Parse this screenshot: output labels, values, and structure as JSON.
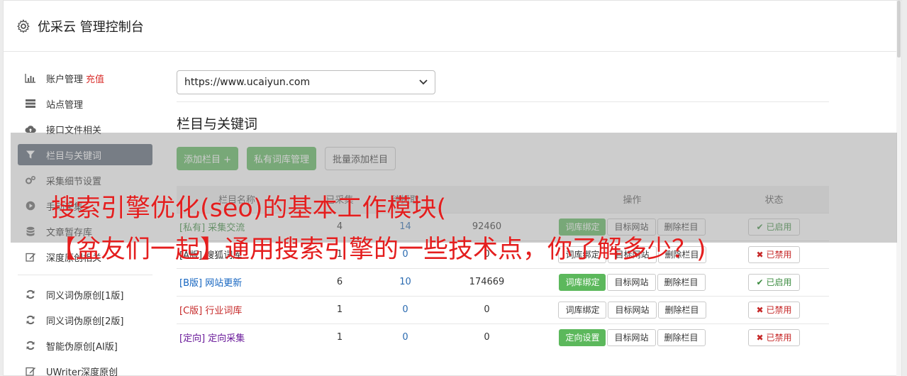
{
  "header": {
    "title": "优采云 管理控制台"
  },
  "sidebar": {
    "items": [
      {
        "label": "账户管理",
        "badge": "充值",
        "icon": "bar-chart-icon"
      },
      {
        "label": "站点管理",
        "icon": "server-icon"
      },
      {
        "label": "接口文件相关",
        "icon": "cloud-upload-icon"
      },
      {
        "label": "栏目与关键词",
        "icon": "filter-icon"
      },
      {
        "label": "采集细节设置",
        "icon": "cogs-icon"
      },
      {
        "label": "手动采集",
        "icon": "play-circle-icon"
      },
      {
        "label": "文章暂存库",
        "icon": "database-icon"
      },
      {
        "label": "深度原创相关",
        "icon": "edit-icon"
      }
    ],
    "items2": [
      {
        "label": "同义词伪原创[1版]",
        "icon": "refresh-icon"
      },
      {
        "label": "同义词伪原创[2版]",
        "icon": "refresh-icon"
      },
      {
        "label": "智能伪原创[AI版]",
        "icon": "refresh-icon"
      },
      {
        "label": "UWriter深度原创",
        "icon": "edit-icon"
      }
    ]
  },
  "main": {
    "site_select": "https://www.ucaiyun.com",
    "section_title": "栏目与关键词",
    "buttons": {
      "add_column": "添加栏目 +",
      "private_lib": "私有词库管理",
      "batch_add": "批量添加栏目"
    },
    "table": {
      "headers": [
        "栏目名称",
        "已采集",
        "待抓取",
        "",
        "操作",
        "状态"
      ],
      "rows": [
        {
          "tag": "[私有]",
          "name": "采集交流",
          "collected": "4",
          "pending": "14",
          "count": "92460",
          "op1": "词库绑定",
          "op1_green": true,
          "op2": "目标网站",
          "op3": "删除栏目",
          "status": "已启用",
          "status_on": true,
          "color": "green"
        },
        {
          "tag": "[A版]",
          "name": "搜狐词库",
          "collected": "1",
          "pending": "0",
          "count": "0",
          "op1": "词库绑定",
          "op1_green": false,
          "op2": "目标网站",
          "op3": "删除栏目",
          "status": "已禁用",
          "status_on": false,
          "color": "default"
        },
        {
          "tag": "[B版]",
          "name": "网站更新",
          "collected": "6",
          "pending": "10",
          "count": "174669",
          "op1": "词库绑定",
          "op1_green": true,
          "op2": "目标网站",
          "op3": "删除栏目",
          "status": "已启用",
          "status_on": true,
          "color": "blue"
        },
        {
          "tag": "[C版]",
          "name": "行业词库",
          "collected": "1",
          "pending": "0",
          "count": "0",
          "op1": "词库绑定",
          "op1_green": false,
          "op2": "目标网站",
          "op3": "删除栏目",
          "status": "已禁用",
          "status_on": false,
          "color": "red"
        },
        {
          "tag": "[定向]",
          "name": "定向采集",
          "collected": "1",
          "pending": "0",
          "count": "0",
          "op1": "定向设置",
          "op1_green": true,
          "op2": "目标网站",
          "op3": "删除栏目",
          "status": "已禁用",
          "status_on": false,
          "color": "purple"
        }
      ]
    }
  },
  "overlay": {
    "line1": "搜索引擎优化(seo)的基本工作模块(",
    "line2": "【盆友们一起】通用搜索引擎的一些技术点，你了解多少？)"
  }
}
